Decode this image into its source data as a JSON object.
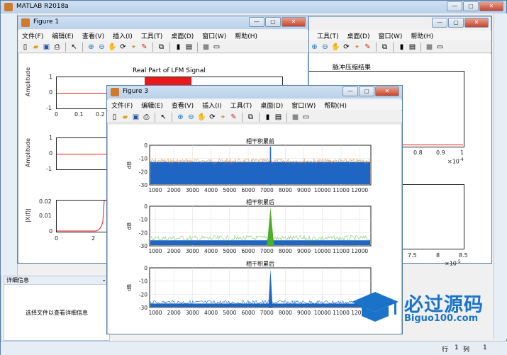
{
  "matlab": {
    "title": "MATLAB R2018a",
    "detail_header": "详细信息",
    "detail_text": "选择文件以查看详细信息",
    "status_row": "行",
    "status_row_val": "1",
    "status_col": "列",
    "status_col_val": "1"
  },
  "menus": [
    "文件(F)",
    "编辑(E)",
    "查看(V)",
    "插入(I)",
    "工具(T)",
    "桌面(D)",
    "窗口(W)",
    "帮助(H)"
  ],
  "menus_right": [
    "工具(T)",
    "桌面(D)",
    "窗口(W)",
    "帮助(H)"
  ],
  "fig1": {
    "title": "Figure 1",
    "plot_title": "Real Part of LFM Signal",
    "amp_label": "Amplitude",
    "amp_label2": "Amplitude",
    "spec_label": "|X(f)|",
    "ticks_x1": [
      "0",
      "0.1",
      "0.2"
    ],
    "ticks_y1": [
      "1",
      "0",
      "-1"
    ],
    "ticks_y2": [
      "1",
      "0",
      "-1"
    ],
    "ticks_y3": [
      "0.02",
      "0.01",
      "0"
    ],
    "ticks_x3": [
      "0",
      "2"
    ]
  },
  "fig2": {
    "plot_title": "脉冲压缩结果",
    "ticks_x1": [
      "0.8",
      "0.9",
      "1"
    ],
    "exp1": "×10",
    "exp1_pow": "-4",
    "ticks_x2": [
      "7.5",
      "8",
      "8.5"
    ],
    "exp2": "×10",
    "exp2_pow": "-5"
  },
  "fig3": {
    "title": "Figure 3",
    "plots": [
      {
        "title": "相干积累前",
        "ylabel": "dB",
        "yticks": [
          "0",
          "-10",
          "-20",
          "-30"
        ],
        "xticks": [
          "1000",
          "2000",
          "3000",
          "4000",
          "5000",
          "6000",
          "7000",
          "8000",
          "9000",
          "10000",
          "11000",
          "12000"
        ]
      },
      {
        "title": "相干积累后",
        "ylabel": "dB",
        "yticks": [
          "0",
          "-10",
          "-20",
          "-30"
        ],
        "xticks": [
          "1000",
          "2000",
          "3000",
          "4000",
          "5000",
          "6000",
          "7000",
          "8000",
          "9000",
          "10000",
          "11000",
          "12000"
        ]
      },
      {
        "title": "相干积累后",
        "ylabel": "dB",
        "yticks": [
          "0",
          "-10",
          "-20",
          "-30"
        ],
        "xticks": [
          "1000",
          "2000",
          "3000",
          "4000",
          "5000",
          "6000",
          "7000",
          "8000",
          "9000",
          "10000",
          "11000",
          "12000"
        ]
      }
    ]
  },
  "watermark": {
    "main": "必过源码",
    "sub": "Biguo100.com"
  },
  "colors": {
    "blue": "#1f66c4",
    "red": "#e8191a",
    "green": "#4caf2a",
    "orange": "#e07b1f"
  }
}
